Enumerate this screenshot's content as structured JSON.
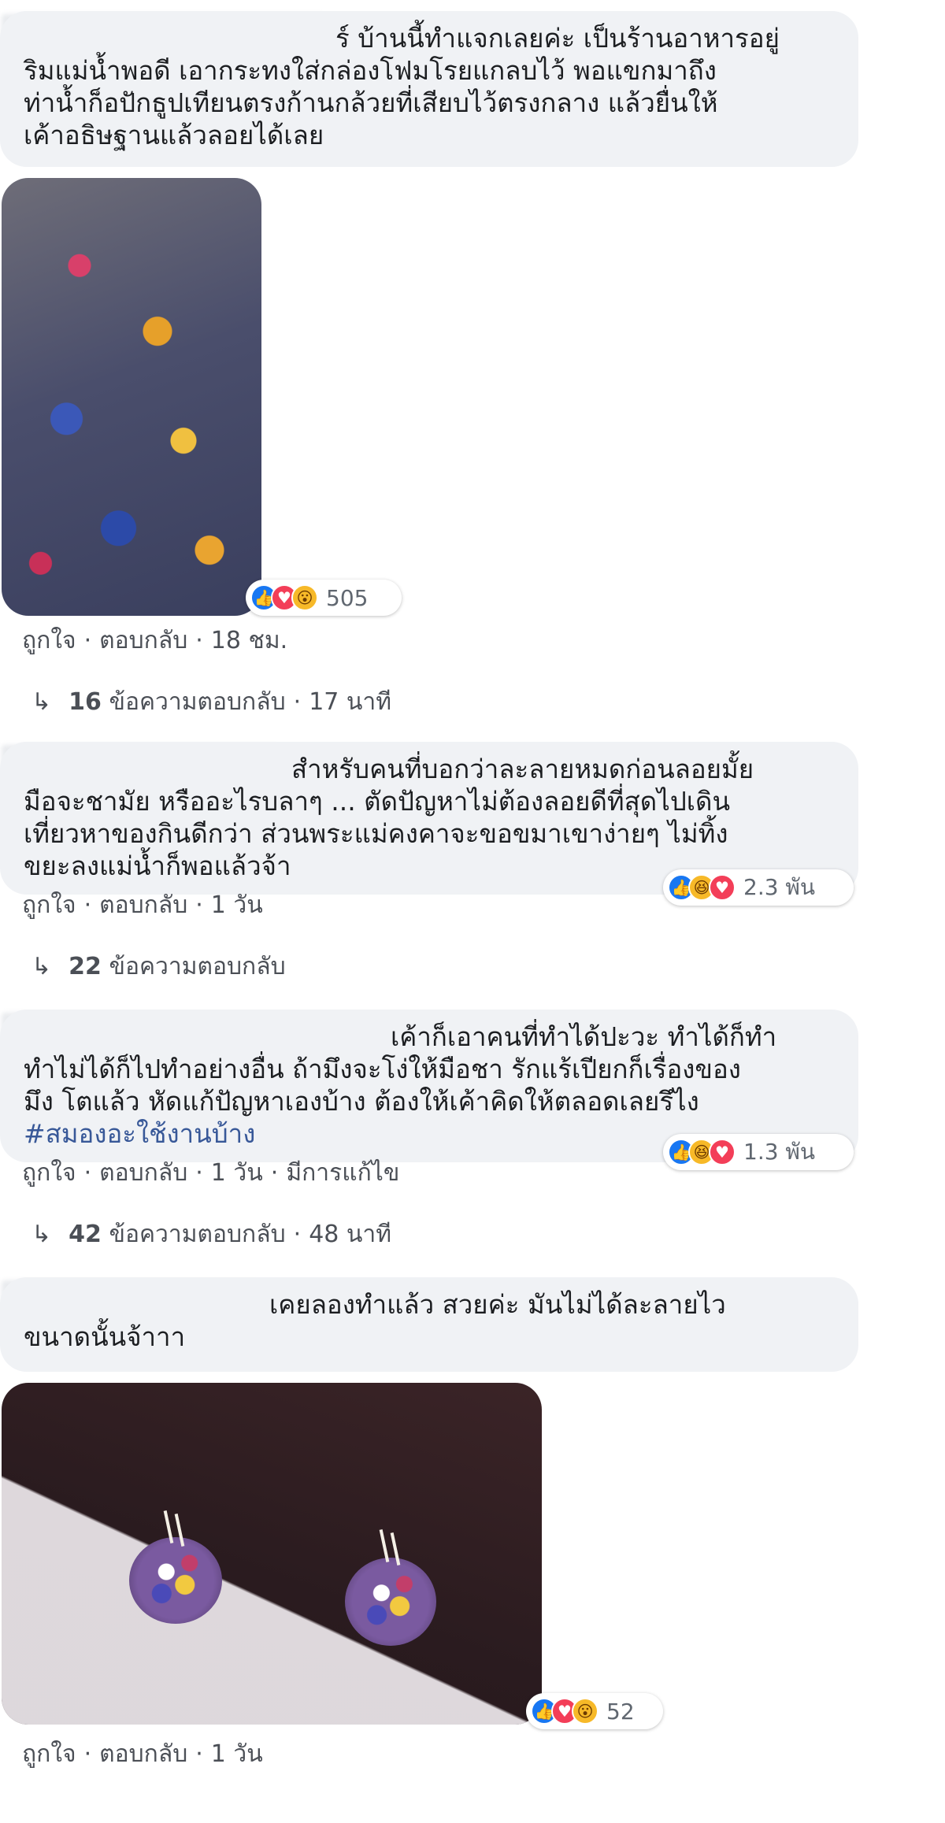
{
  "comments": [
    {
      "text": "ร์ บ้านนี้ทำแจกเลยค่ะ เป็นร้านอาหารอยู่ริมแม่น้ำพอดี เอากระทงใส่กล่องโฟมโรยแกลบไว้ พอแขกมาถึงท่าน้ำก็อปักธูปเทียนตรงก้านกล้วยที่เสียบไว้ตรงกลาง แล้วยื่นให้เค้าอธิษฐานแล้วลอยได้เลย",
      "lines": [
        "ร์ บ้านนี้ทำแจกเลยค่ะ เป็นร้านอาหารอยู่",
        "ริมแม่น้ำพอดี เอากระทงใส่กล่องโฟมโรยแกลบไว้ พอแขกมาถึง",
        "ท่าน้ำก็อปักธูปเทียนตรงก้านกล้วยที่เสียบไว้ตรงกลาง แล้วยื่นให้",
        "เค้าอธิษฐานแล้วลอยได้เลย"
      ],
      "reactions": {
        "icons": [
          "like-icon",
          "love-icon",
          "wow-icon"
        ],
        "count": "505"
      },
      "meta": {
        "like": "ถูกใจ",
        "reply": "ตอบกลับ",
        "time": "18 ชม."
      },
      "replies": {
        "count": "16",
        "label": "ข้อความตอบกลับ",
        "time": "17 นาที"
      }
    },
    {
      "lines": [
        "สำหรับคนที่บอกว่าละลายหมดก่อนลอยมั้ย",
        "มือจะชามัย หรืออะไรบลาๆ ... ตัดปัญหาไม่ต้องลอยดีที่สุดไปเดิน",
        "เที่ยวหาของกินดีกว่า ส่วนพระแม่คงคาจะขอขมาเขาง่ายๆ ไม่ทิ้ง",
        "ขยะลงแม่น้ำก็พอแล้วจ้า"
      ],
      "reactions": {
        "icons": [
          "like-icon",
          "haha-icon",
          "love-icon"
        ],
        "count": "2.3 พัน"
      },
      "meta": {
        "like": "ถูกใจ",
        "reply": "ตอบกลับ",
        "time": "1 วัน"
      },
      "replies": {
        "count": "22",
        "label": "ข้อความตอบกลับ"
      }
    },
    {
      "lines": [
        "เค้าก็เอาคนที่ทำได้ปะวะ ทำได้ก็ทำ",
        "ทำไม่ได้ก็ไปทำอย่างอื่น ถ้ามึงจะโง่ให้มือชา รักแร้เปียกก็เรื่องของ",
        "มึง โตแล้ว หัดแก้ปัญหาเองบ้าง ต้องให้เค้าคิดให้ตลอดเลยรึไง"
      ],
      "hashtag": "#สมองอะใช้งานบ้าง",
      "reactions": {
        "icons": [
          "like-icon",
          "haha-icon",
          "love-icon"
        ],
        "count": "1.3 พัน"
      },
      "meta": {
        "like": "ถูกใจ",
        "reply": "ตอบกลับ",
        "time": "1 วัน",
        "edited": "มีการแก้ไข"
      },
      "replies": {
        "count": "42",
        "label": "ข้อความตอบกลับ",
        "time": "48 นาที"
      }
    },
    {
      "lines": [
        "เคยลองทำแล้ว สวยค่ะ มันไม่ได้ละลายไว",
        "ขนาดนั้นจ้าาา"
      ],
      "reactions": {
        "icons": [
          "like-icon",
          "love-icon",
          "wow-icon"
        ],
        "count": "52"
      },
      "meta": {
        "like": "ถูกใจ",
        "reply": "ตอบกลับ",
        "time": "1 วัน"
      }
    }
  ],
  "colors": {
    "bubble": "#f0f2f5",
    "like": "#1877f2",
    "love": "#f33e58",
    "haha": "#f7b928",
    "meta": "#4b4f56"
  }
}
